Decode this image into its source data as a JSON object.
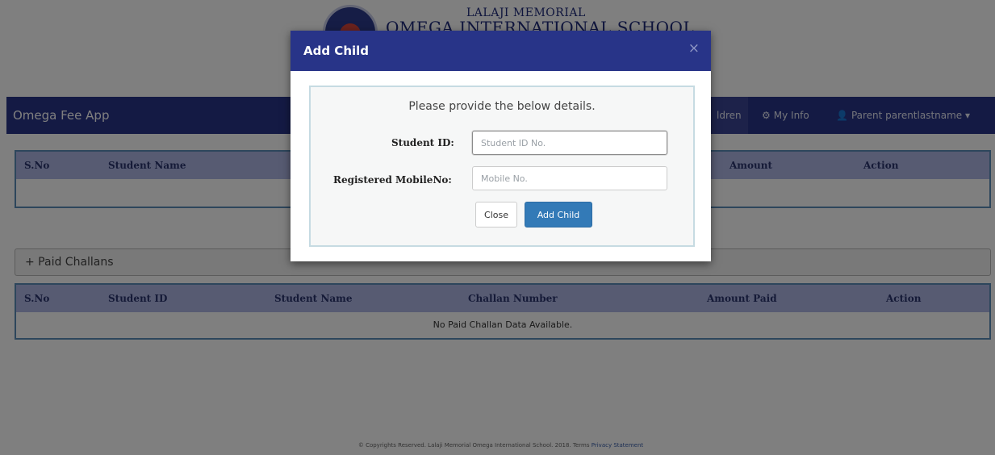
{
  "header": {
    "school_line1": "LALAJI MEMORIAL",
    "school_line2": "OMEGA INTERNATIONAL SCHOOL"
  },
  "navbar": {
    "brand": "Omega Fee App",
    "items": [
      {
        "label": "ldren",
        "icon": "children-icon"
      },
      {
        "label": "My Info",
        "icon": "gear-icon"
      },
      {
        "label": "Parent parentlastname",
        "icon": "user-icon",
        "caret": "▾"
      }
    ]
  },
  "challans_table": {
    "columns": [
      "S.No",
      "Student Name",
      "Amount",
      "Action"
    ]
  },
  "paid_panel": {
    "label": "+ Paid Challans"
  },
  "paid_table": {
    "columns": [
      "S.No",
      "Student ID",
      "Student Name",
      "Challan Number",
      "Amount Paid",
      "Action"
    ],
    "empty_message": "No Paid Challan Data Available."
  },
  "footer": {
    "text": "© Copyrights Reserved. Lalaji Memorial Omega International School. 2018. Terms",
    "link": "Privacy Statement"
  },
  "modal": {
    "title": "Add Child",
    "close_symbol": "×",
    "intro": "Please provide the below details.",
    "student_id_label": "Student ID:",
    "student_id_placeholder": "Student ID No.",
    "mobile_label": "Registered MobileNo:",
    "mobile_placeholder": "Mobile No.",
    "close_button": "Close",
    "add_button": "Add Child"
  },
  "colors": {
    "navbar": "#283488",
    "table_header": "#aeb6e5",
    "primary_button": "#337ab7"
  }
}
